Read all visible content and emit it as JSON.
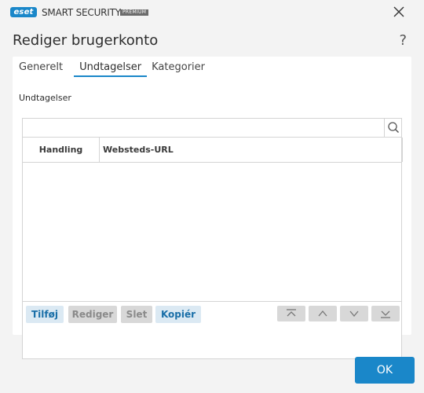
{
  "titlebar": {
    "logo_text": "eset",
    "product_name": "SMART SECURITY",
    "edition": "PREMIUM",
    "close_icon": "close-icon"
  },
  "dialog": {
    "title": "Rediger brugerkonto",
    "help_label": "?"
  },
  "tabs": [
    {
      "label": "Generelt",
      "active": false
    },
    {
      "label": "Undtagelser",
      "active": true
    },
    {
      "label": "Kategorier",
      "active": false
    }
  ],
  "section_label": "Undtagelser",
  "search": {
    "value": "",
    "placeholder": "",
    "icon": "search-icon"
  },
  "table": {
    "columns": [
      "Handling",
      "Websteds-URL"
    ],
    "rows": []
  },
  "toolbar": {
    "add_label": "Tilføj",
    "edit_label": "Rediger",
    "delete_label": "Slet",
    "copy_label": "Kopiér",
    "move_icons": [
      "move-to-top-icon",
      "move-up-icon",
      "move-down-icon",
      "move-to-bottom-icon"
    ]
  },
  "footer": {
    "ok_label": "OK"
  },
  "colors": {
    "accent": "#1a87c9",
    "background": "#f3f3f3",
    "panel": "#ffffff",
    "button_enabled_bg": "#dbe9f3",
    "button_disabled_bg": "#d8d8d8"
  }
}
